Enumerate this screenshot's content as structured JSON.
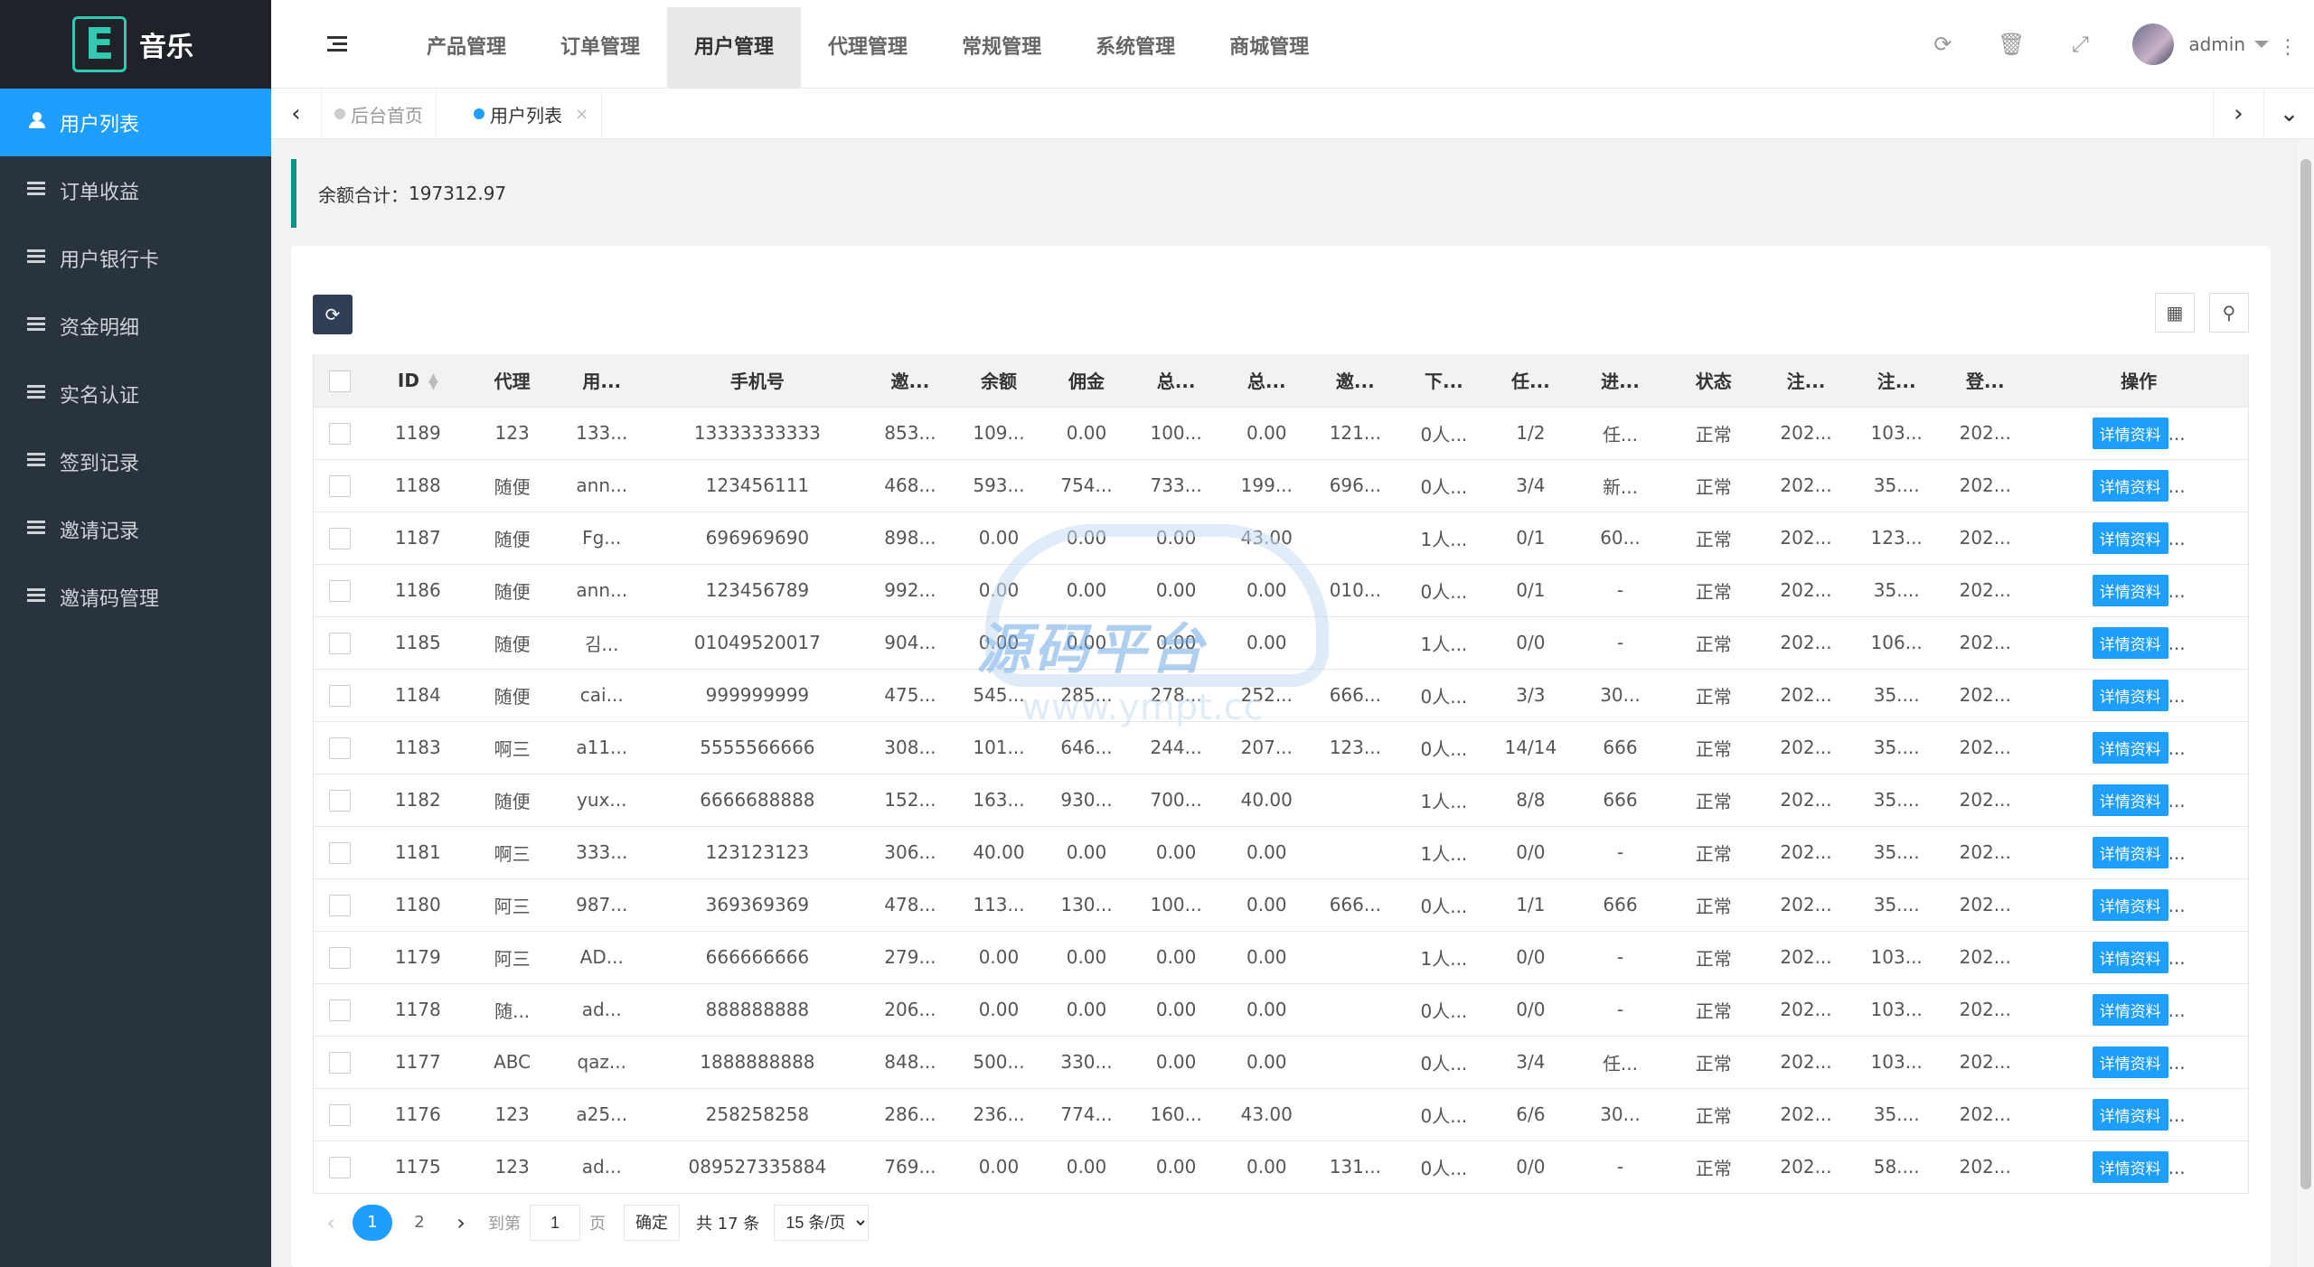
{
  "app": {
    "logo_letter": "E",
    "logo_text": "音乐"
  },
  "sidebar": {
    "items": [
      {
        "label": "用户列表",
        "icon": "users-icon",
        "active": true
      },
      {
        "label": "订单收益",
        "icon": "list-icon"
      },
      {
        "label": "用户银行卡",
        "icon": "list-icon"
      },
      {
        "label": "资金明细",
        "icon": "list-icon"
      },
      {
        "label": "实名认证",
        "icon": "list-icon"
      },
      {
        "label": "签到记录",
        "icon": "list-icon"
      },
      {
        "label": "邀请记录",
        "icon": "list-icon"
      },
      {
        "label": "邀请码管理",
        "icon": "list-icon"
      }
    ]
  },
  "header": {
    "nav": [
      "产品管理",
      "订单管理",
      "用户管理",
      "代理管理",
      "常规管理",
      "系统管理",
      "商城管理"
    ],
    "active_nav": "用户管理",
    "user_name": "admin"
  },
  "tabs": {
    "home": "后台首页",
    "current": "用户列表"
  },
  "summary": {
    "label": "余额合计：",
    "value": "197312.97"
  },
  "table": {
    "columns": [
      "ID",
      "代理",
      "用...",
      "手机号",
      "邀...",
      "余额",
      "佣金",
      "总...",
      "总...",
      "邀...",
      "下...",
      "任...",
      "进...",
      "状态",
      "注...",
      "注...",
      "登...",
      "操作"
    ],
    "op_label": "详情资料",
    "rows": [
      [
        "1189",
        "123",
        "133...",
        "13333333333",
        "853...",
        "109...",
        "0.00",
        "100...",
        "0.00",
        "121...",
        "0人...",
        "1/2",
        "任...",
        "正常",
        "202...",
        "103...",
        "202..."
      ],
      [
        "1188",
        "随便",
        "ann...",
        "123456111",
        "468...",
        "593...",
        "754...",
        "733...",
        "199...",
        "696...",
        "0人...",
        "3/4",
        "新...",
        "正常",
        "202...",
        "35....",
        "202..."
      ],
      [
        "1187",
        "随便",
        "Fg...",
        "696969690",
        "898...",
        "0.00",
        "0.00",
        "0.00",
        "43.00",
        "",
        "1人...",
        "0/1",
        "60...",
        "正常",
        "202...",
        "123...",
        "202..."
      ],
      [
        "1186",
        "随便",
        "ann...",
        "123456789",
        "992...",
        "0.00",
        "0.00",
        "0.00",
        "0.00",
        "010...",
        "0人...",
        "0/1",
        "-",
        "正常",
        "202...",
        "35....",
        "202..."
      ],
      [
        "1185",
        "随便",
        "김...",
        "01049520017",
        "904...",
        "0.00",
        "0.00",
        "0.00",
        "0.00",
        "",
        "1人...",
        "0/0",
        "-",
        "正常",
        "202...",
        "106...",
        "202..."
      ],
      [
        "1184",
        "随便",
        "cai...",
        "999999999",
        "475...",
        "545...",
        "285...",
        "278...",
        "252...",
        "666...",
        "0人...",
        "3/3",
        "30...",
        "正常",
        "202...",
        "35....",
        "202..."
      ],
      [
        "1183",
        "啊三",
        "a11...",
        "5555566666",
        "308...",
        "101...",
        "646...",
        "244...",
        "207...",
        "123...",
        "0人...",
        "14/14",
        "666",
        "正常",
        "202...",
        "35....",
        "202..."
      ],
      [
        "1182",
        "随便",
        "yux...",
        "6666688888",
        "152...",
        "163...",
        "930...",
        "700...",
        "40.00",
        "",
        "1人...",
        "8/8",
        "666",
        "正常",
        "202...",
        "35....",
        "202..."
      ],
      [
        "1181",
        "啊三",
        "333...",
        "123123123",
        "306...",
        "40.00",
        "0.00",
        "0.00",
        "0.00",
        "",
        "1人...",
        "0/0",
        "-",
        "正常",
        "202...",
        "35....",
        "202..."
      ],
      [
        "1180",
        "阿三",
        "987...",
        "369369369",
        "478...",
        "113...",
        "130...",
        "100...",
        "0.00",
        "666...",
        "0人...",
        "1/1",
        "666",
        "正常",
        "202...",
        "35....",
        "202..."
      ],
      [
        "1179",
        "阿三",
        "AD...",
        "666666666",
        "279...",
        "0.00",
        "0.00",
        "0.00",
        "0.00",
        "",
        "1人...",
        "0/0",
        "-",
        "正常",
        "202...",
        "103...",
        "202..."
      ],
      [
        "1178",
        "随...",
        "ad...",
        "888888888",
        "206...",
        "0.00",
        "0.00",
        "0.00",
        "0.00",
        "",
        "0人...",
        "0/0",
        "-",
        "正常",
        "202...",
        "103...",
        "202..."
      ],
      [
        "1177",
        "ABC",
        "qaz...",
        "1888888888",
        "848...",
        "500...",
        "330...",
        "0.00",
        "0.00",
        "",
        "0人...",
        "3/4",
        "任...",
        "正常",
        "202...",
        "103...",
        "202..."
      ],
      [
        "1176",
        "123",
        "a25...",
        "258258258",
        "286...",
        "236...",
        "774...",
        "160...",
        "43.00",
        "",
        "0人...",
        "6/6",
        "30...",
        "正常",
        "202...",
        "35....",
        "202..."
      ],
      [
        "1175",
        "123",
        "ad...",
        "089527335884",
        "769...",
        "0.00",
        "0.00",
        "0.00",
        "0.00",
        "131...",
        "0人...",
        "0/0",
        "-",
        "正常",
        "202...",
        "58....",
        "202..."
      ]
    ]
  },
  "pagination": {
    "pages": [
      "1",
      "2"
    ],
    "current": "1",
    "goto_prefix": "到第",
    "goto_value": "1",
    "goto_suffix": "页",
    "confirm": "确定",
    "total": "共 17 条",
    "page_size": "15 条/页"
  },
  "watermark": {
    "text": "源码平台",
    "url": "www.ympt.cc"
  }
}
